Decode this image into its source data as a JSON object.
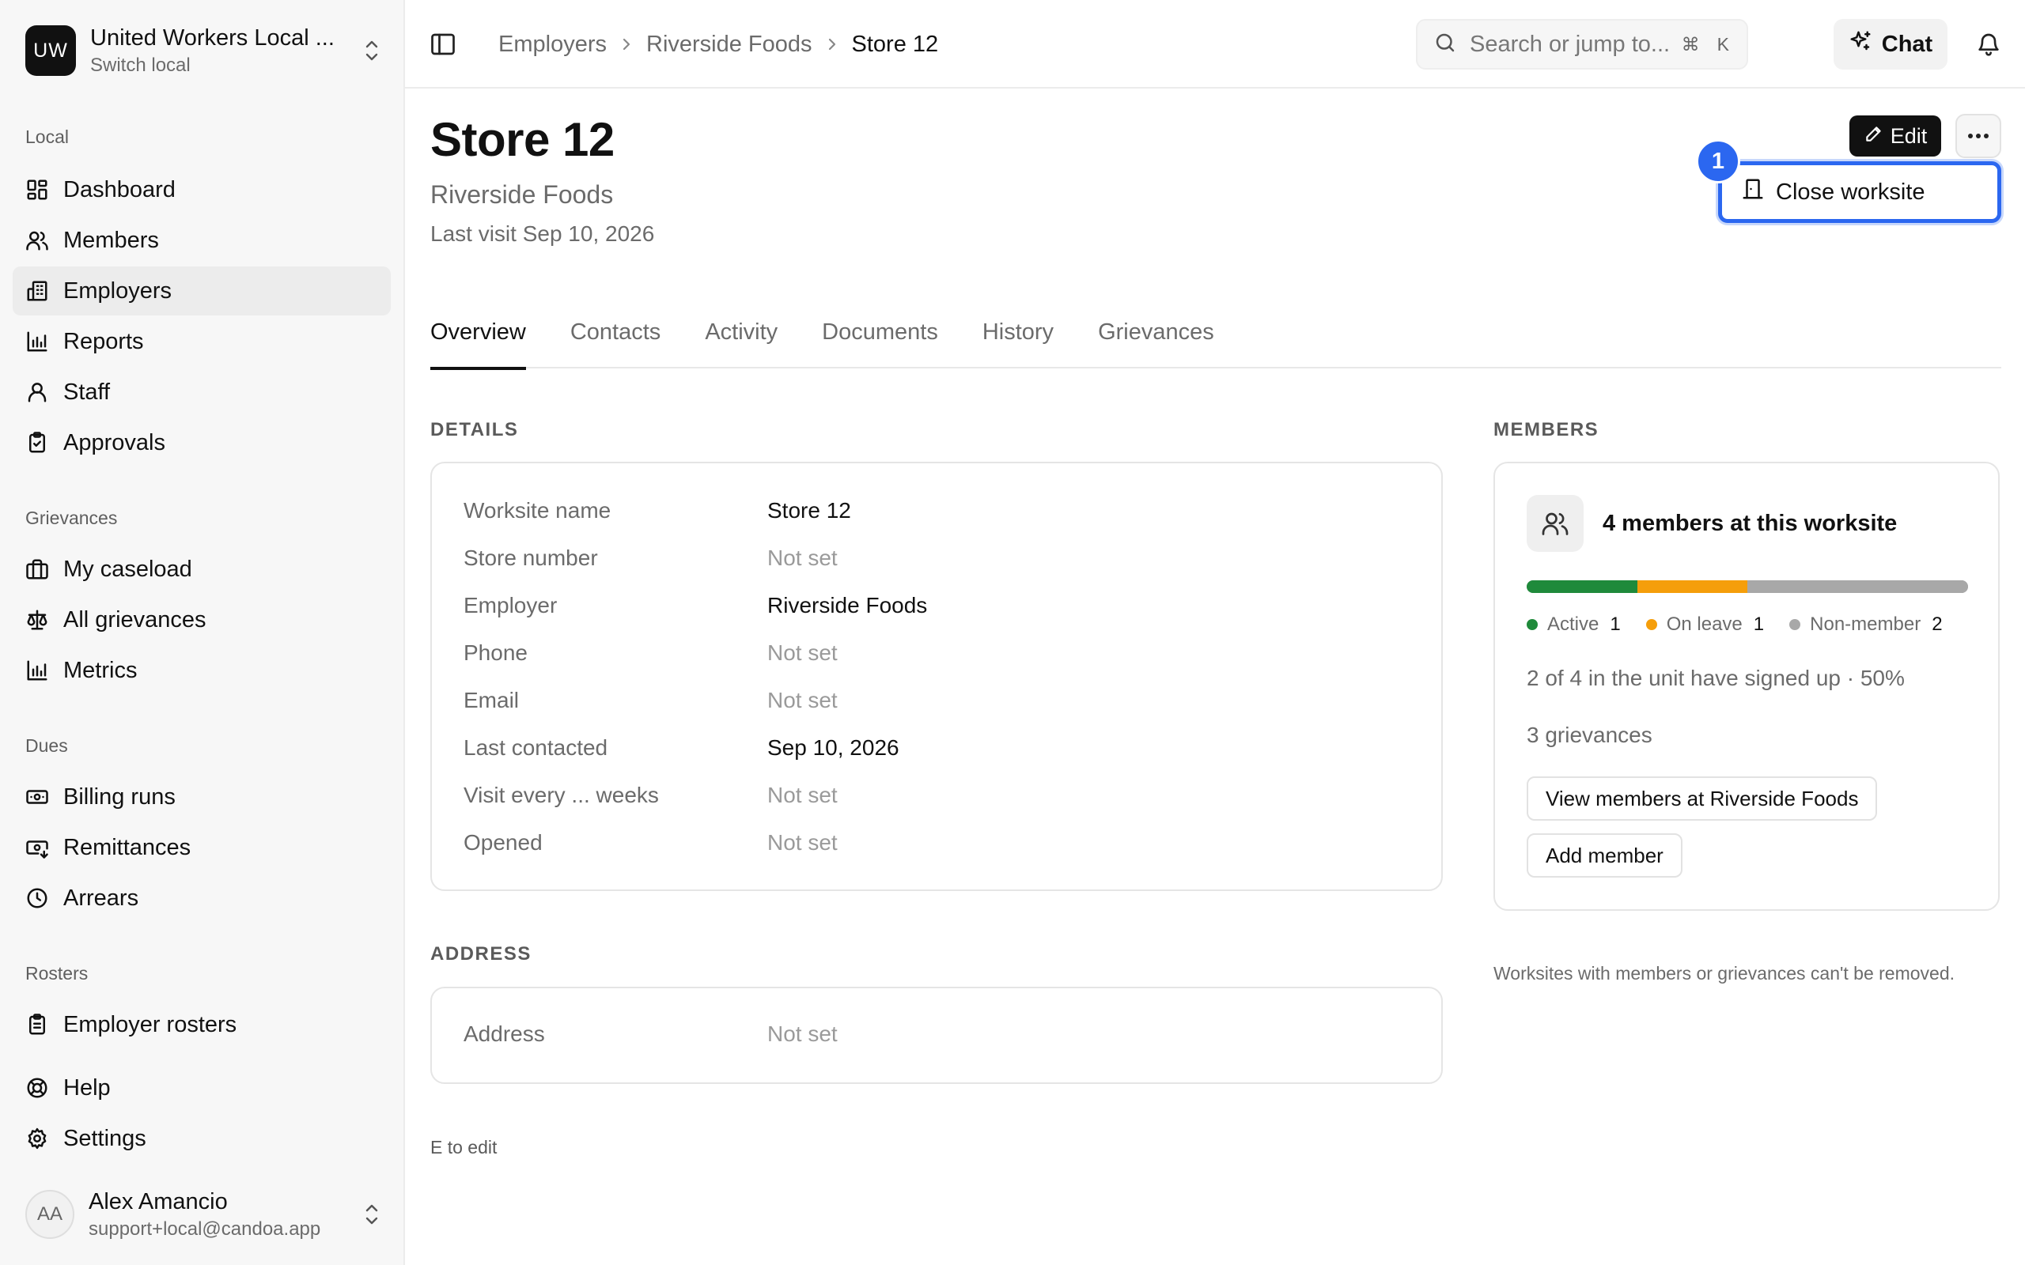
{
  "sidebar": {
    "org": {
      "initials": "UW",
      "name": "United Workers Local ...",
      "sub": "Switch local"
    },
    "sections": [
      {
        "label": "Local"
      },
      {
        "label": "Grievances"
      },
      {
        "label": "Dues"
      },
      {
        "label": "Rosters"
      }
    ],
    "items": [
      {
        "label": "Dashboard",
        "icon": "dashboard-icon"
      },
      {
        "label": "Members",
        "icon": "users-icon"
      },
      {
        "label": "Employers",
        "icon": "building-icon"
      },
      {
        "label": "Reports",
        "icon": "bar-chart-icon"
      },
      {
        "label": "Staff",
        "icon": "user-icon"
      },
      {
        "label": "Approvals",
        "icon": "clipboard-check-icon"
      },
      {
        "label": "My caseload",
        "icon": "briefcase-icon"
      },
      {
        "label": "All grievances",
        "icon": "scale-icon"
      },
      {
        "label": "Metrics",
        "icon": "bar-chart-icon"
      },
      {
        "label": "Billing runs",
        "icon": "banknote-icon"
      },
      {
        "label": "Remittances",
        "icon": "banknote-arrow-icon"
      },
      {
        "label": "Arrears",
        "icon": "clock-icon"
      },
      {
        "label": "Employer rosters",
        "icon": "clipboard-list-icon"
      },
      {
        "label": "Help",
        "icon": "lifebuoy-icon"
      },
      {
        "label": "Settings",
        "icon": "gear-icon"
      }
    ],
    "user": {
      "initials": "AA",
      "name": "Alex Amancio",
      "email": "support+local@candoa.app"
    }
  },
  "topbar": {
    "breadcrumbs": [
      "Employers",
      "Riverside Foods",
      "Store 12"
    ],
    "search_placeholder": "Search or jump to...",
    "shortcut_cmd": "⌘",
    "shortcut_key": "K",
    "chat_label": "Chat"
  },
  "header": {
    "title": "Store 12",
    "subtitle": "Riverside Foods",
    "last_visit": "Last visit Sep 10, 2026",
    "edit_label": "Edit",
    "menu_item": "Close worksite",
    "step_badge": "1"
  },
  "tabs": [
    {
      "label": "Overview",
      "active": true
    },
    {
      "label": "Contacts",
      "active": false
    },
    {
      "label": "Activity",
      "active": false
    },
    {
      "label": "Documents",
      "active": false
    },
    {
      "label": "History",
      "active": false
    },
    {
      "label": "Grievances",
      "active": false
    }
  ],
  "details": {
    "label": "DETAILS",
    "rows": [
      {
        "key": "Worksite name",
        "value": "Store 12",
        "muted": false
      },
      {
        "key": "Store number",
        "value": "Not set",
        "muted": true
      },
      {
        "key": "Employer",
        "value": "Riverside Foods",
        "muted": false
      },
      {
        "key": "Phone",
        "value": "Not set",
        "muted": true
      },
      {
        "key": "Email",
        "value": "Not set",
        "muted": true
      },
      {
        "key": "Last contacted",
        "value": "Sep 10, 2026",
        "muted": false
      },
      {
        "key": "Visit every ... weeks",
        "value": "Not set",
        "muted": true
      },
      {
        "key": "Opened",
        "value": "Not set",
        "muted": true
      }
    ]
  },
  "address": {
    "label": "ADDRESS",
    "rows": [
      {
        "key": "Address",
        "value": "Not set",
        "muted": true
      }
    ]
  },
  "hint": "E to edit",
  "members": {
    "label": "MEMBERS",
    "title": "4 members at this worksite",
    "total": 4,
    "breakdown": [
      {
        "label": "Active",
        "count": 1,
        "color": "#1f8a3b"
      },
      {
        "label": "On leave",
        "count": 1,
        "color": "#f59e0b"
      },
      {
        "label": "Non-member",
        "count": 2,
        "color": "#a8a8a8"
      }
    ],
    "signup_line": "2 of 4 in the unit have signed up · 50%",
    "grievances_line": "3 grievances",
    "view_button": "View members at Riverside Foods",
    "add_button": "Add member",
    "note": "Worksites with members or grievances can't be removed."
  }
}
